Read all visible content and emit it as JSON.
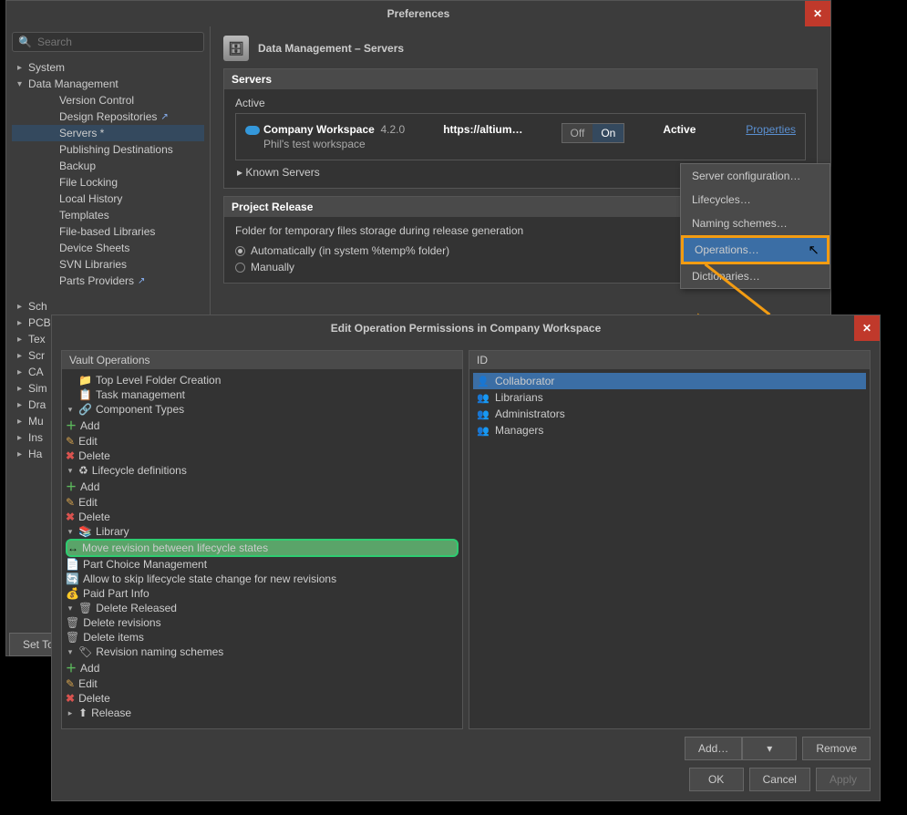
{
  "pref": {
    "title": "Preferences",
    "search_ph": "Search",
    "tree": {
      "system": "System",
      "data_mgmt": "Data Management",
      "version_control": "Version Control",
      "design_repos": "Design Repositories",
      "servers": "Servers *",
      "pub_dest": "Publishing Destinations",
      "backup": "Backup",
      "file_locking": "File Locking",
      "local_history": "Local History",
      "templates": "Templates",
      "file_libs": "File-based Libraries",
      "device_sheets": "Device Sheets",
      "svn_libs": "SVN Libraries",
      "parts_providers": "Parts Providers",
      "sch": "Sch",
      "pcb": "PCB",
      "tex": "Tex",
      "scr": "Scr",
      "cam": "CA",
      "sim": "Sim",
      "dra": "Dra",
      "mu": "Mu",
      "ins": "Ins",
      "har": "Ha"
    },
    "main": {
      "crumb": "Data Management – Servers",
      "servers_h": "Servers",
      "active": "Active",
      "ws_name": "Company Workspace",
      "ws_ver": "4.2.0",
      "ws_desc": "Phil's test workspace",
      "url": "https://altium…",
      "off": "Off",
      "on": "On",
      "status": "Active",
      "props": "Properties",
      "known": "Known Servers",
      "release_h": "Project Release",
      "release_desc": "Folder for temporary files storage during release generation",
      "auto": "Automatically (in system %temp% folder)",
      "manual": "Manually"
    },
    "ctx": {
      "cfg": "Server configuration…",
      "life": "Lifecycles…",
      "naming": "Naming schemes…",
      "ops": "Operations…",
      "dict": "Dictionaries…"
    },
    "setto": "Set To"
  },
  "dlg": {
    "title": "Edit Operation Permissions in Company Workspace",
    "vault_h": "Vault Operations",
    "id_h": "ID",
    "ops": {
      "toplevel": "Top Level Folder Creation",
      "task": "Task management",
      "comp_types": "Component Types",
      "add": "Add",
      "edit": "Edit",
      "delete": "Delete",
      "lifedef": "Lifecycle definitions",
      "library": "Library",
      "move_rev": "Move revision between lifecycle states",
      "part_choice": "Part Choice Management",
      "skip_life": "Allow to skip lifecycle state change for new revisions",
      "paid_part": "Paid Part Info",
      "del_released": "Delete Released",
      "del_rev": "Delete revisions",
      "del_items": "Delete items",
      "rev_naming": "Revision naming schemes",
      "release": "Release"
    },
    "ids": {
      "collab": "Collaborator",
      "lib": "Librarians",
      "admin": "Administrators",
      "mgr": "Managers"
    },
    "add_btn": "Add…",
    "remove": "Remove",
    "ok": "OK",
    "cancel": "Cancel",
    "apply": "Apply"
  }
}
